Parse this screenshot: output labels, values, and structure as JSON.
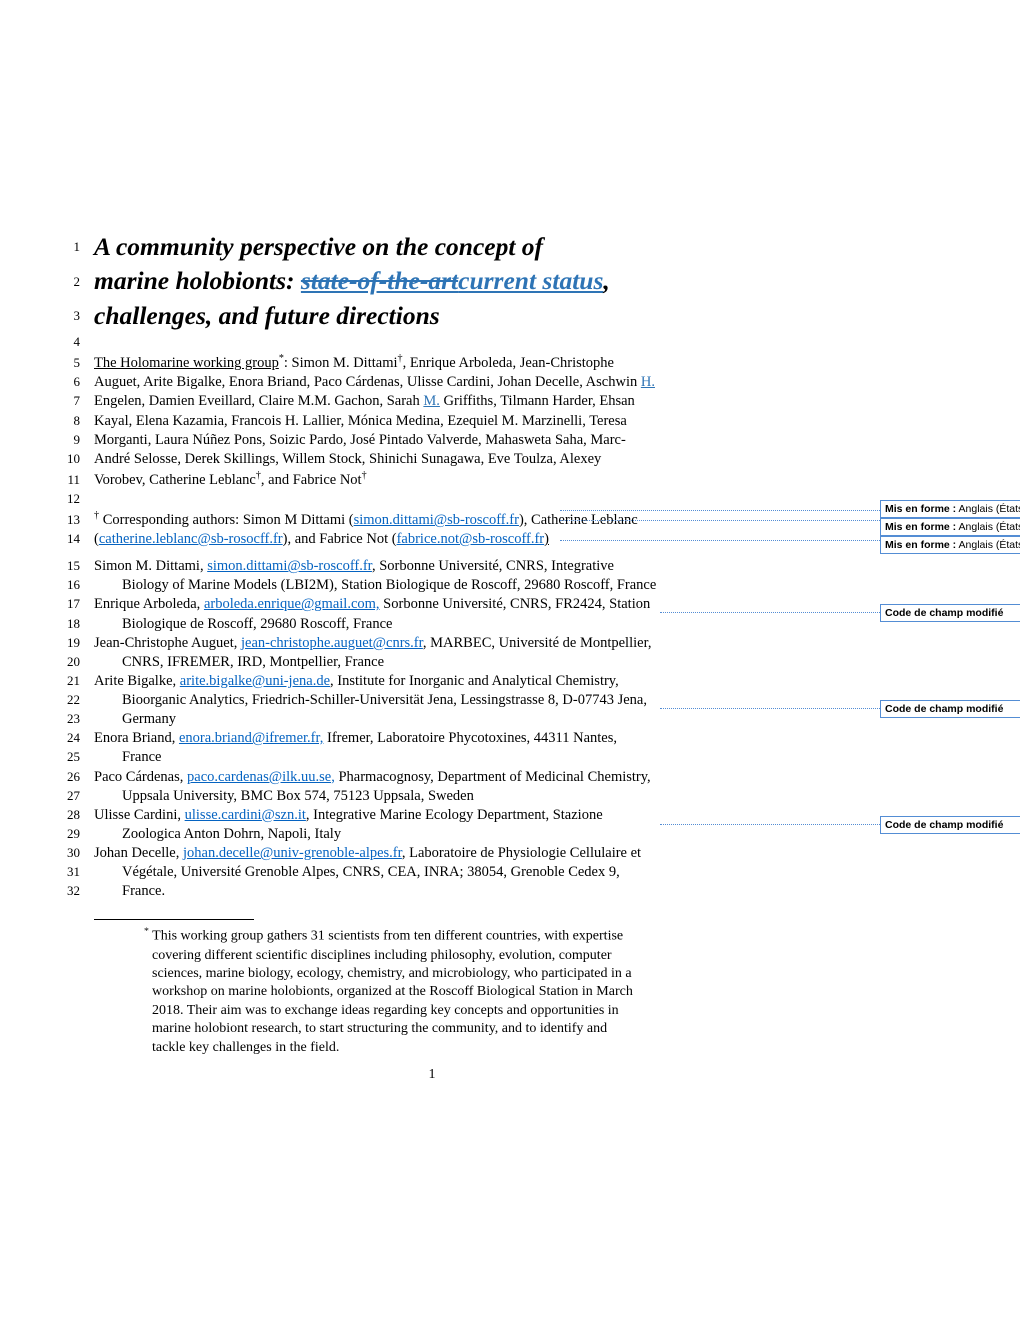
{
  "title": {
    "l1": "A community perspective on the concept of",
    "l2_pre": "marine holobionts: ",
    "l2_strike": "state-of-the-art",
    "l2_ins": "current status",
    "l2_post": ",",
    "l3": "challenges, and future directions"
  },
  "lines": {
    "4": "",
    "5_pre": "The Holomarine working group",
    "5_mid": ": Simon M. Dittami",
    "5_post": ", Enrique Arboleda, Jean-Christophe",
    "6_a": "Auguet, Arite Bigalke, Enora Briand, Paco Cárdenas, Ulisse Cardini, Johan Decelle, Aschwin ",
    "6_ins": "H.",
    "7_a": "Engelen, Damien Eveillard, Claire M.M. Gachon, Sarah ",
    "7_ins": "M.",
    "7_b": " Griffiths, Tilmann Harder, Ehsan",
    "8": "Kayal, Elena Kazamia, Francois H. Lallier, Mónica Medina, Ezequiel M. Marzinelli, Teresa",
    "9": "Morganti, Laura Núñez Pons, Soizic Pardo, José Pintado Valverde, Mahasweta Saha, Marc-",
    "10": "André Selosse, Derek Skillings, Willem Stock, Shinichi Sunagawa, Eve Toulza, Alexey",
    "11_a": "Vorobev, Catherine Leblanc",
    "11_b": ", and Fabrice Not",
    "12": "",
    "13_a": " Corresponding authors: Simon M Dittami (",
    "13_link": "simon.dittami@sb-roscoff.fr",
    "13_b": "), Catherine Leblanc",
    "14_a": "(",
    "14_link1": "catherine.leblanc@sb-rosocff.fr",
    "14_b": "), and Fabrice Not (",
    "14_link2": "fabrice.not@sb-roscoff.fr",
    "14_c": ")",
    "15_a": "Simon M. Dittami, ",
    "15_link": "simon.dittami@sb-roscoff.fr",
    "15_b": ", Sorbonne Université, CNRS, Integrative",
    "16": "Biology of Marine Models (LBI2M), Station Biologique de Roscoff, 29680 Roscoff, France",
    "17_a": "Enrique Arboleda, ",
    "17_link": "arboleda.enrique@gmail.com,",
    "17_b": " Sorbonne Université, CNRS, FR2424, Station",
    "18": "Biologique de Roscoff, 29680 Roscoff, France",
    "19_a": "Jean-Christophe Auguet, ",
    "19_link": "jean-christophe.auguet@cnrs.fr",
    "19_b": ", MARBEC, Université de Montpellier,",
    "20": "CNRS, IFREMER, IRD, Montpellier, France",
    "21_a": "Arite Bigalke, ",
    "21_link": "arite.bigalke@uni-jena.de",
    "21_b": ", Institute for Inorganic and Analytical Chemistry,",
    "22": "Bioorganic Analytics, Friedrich-Schiller-Universität Jena, Lessingstrasse 8, D-07743 Jena,",
    "23": "Germany",
    "24_a": "Enora Briand, ",
    "24_link": "enora.briand@ifremer.fr,",
    "24_b": " Ifremer, Laboratoire Phycotoxines, 44311 Nantes,",
    "25": "France",
    "26_a": "Paco Cárdenas, ",
    "26_link": "paco.cardenas@ilk.uu.se,",
    "26_b": " Pharmacognosy, Department of Medicinal Chemistry,",
    "27": "Uppsala University, BMC Box 574, 75123 Uppsala, Sweden",
    "28_a": "Ulisse Cardini, ",
    "28_link": "ulisse.cardini@szn.it",
    "28_b": ", Integrative Marine Ecology Department, Stazione",
    "29": "Zoologica Anton Dohrn, Napoli, Italy",
    "30_a": "Johan Decelle, ",
    "30_link": "johan.decelle@univ-grenoble-alpes.fr",
    "30_b": ", Laboratoire de Physiologie Cellulaire et",
    "31": "Végétale, Université Grenoble Alpes, CNRS, CEA, INRA; 38054, Grenoble Cedex 9,",
    "32": "France."
  },
  "footnote": {
    "text": " This working group gathers 31 scientists from ten different countries, with expertise covering different scientific disciplines including philosophy, evolution, computer sciences, marine biology, ecology, chemistry, and microbiology, who participated in a workshop on marine holobionts, organized at the Roscoff Biological Station in March 2018. Their aim was to exchange ideas regarding key concepts and opportunities in marine holobiont research, to start structuring the community, and to identify and tackle key challenges in the field."
  },
  "page_number": "1",
  "comments": {
    "c1_lbl": "Mis en forme :",
    "c1_txt": " Anglais (États-Unis)",
    "c2_lbl": "Mis en forme :",
    "c2_txt": " Anglais (États-Unis)",
    "c3_lbl": "Mis en forme :",
    "c3_txt": " Anglais (États-Unis)",
    "c4_lbl": "Code de champ modifié",
    "c5_lbl": "Code de champ modifié",
    "c6_lbl": "Code de champ modifié"
  },
  "line_numbers": {
    "l1": "1",
    "l2": "2",
    "l3": "3",
    "l4": "4",
    "l5": "5",
    "l6": "6",
    "l7": "7",
    "l8": "8",
    "l9": "9",
    "l10": "10",
    "l11": "11",
    "l12": "12",
    "l13": "13",
    "l14": "14",
    "l15": "15",
    "l16": "16",
    "l17": "17",
    "l18": "18",
    "l19": "19",
    "l20": "20",
    "l21": "21",
    "l22": "22",
    "l23": "23",
    "l24": "24",
    "l25": "25",
    "l26": "26",
    "l27": "27",
    "l28": "28",
    "l29": "29",
    "l30": "30",
    "l31": "31",
    "l32": "32"
  }
}
